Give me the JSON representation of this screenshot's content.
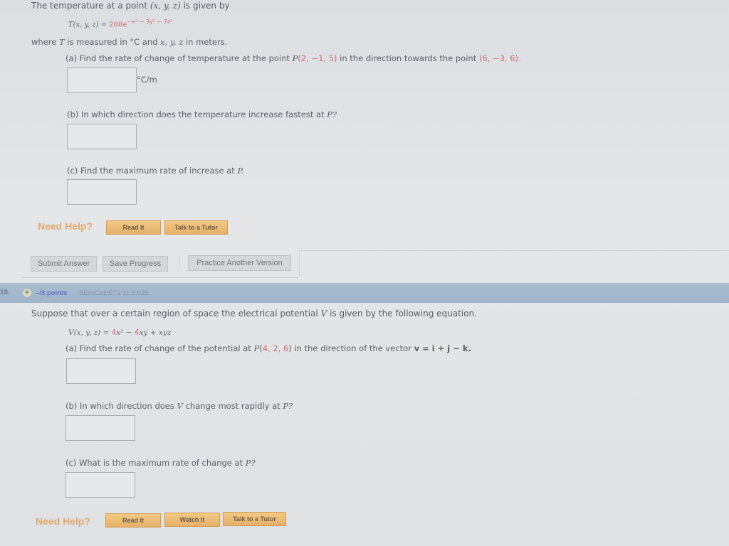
{
  "question9": {
    "intro": "The temperature at a point",
    "intro_vars": "(x, y, z)",
    "intro_end": "is given by",
    "formula_lhs": "T(x, y, z) =",
    "formula_coeff": "200e",
    "formula_exp": "−x² − 3y² − 7z²",
    "where_1": "where",
    "where_T": "T",
    "where_2": "is measured in °C and",
    "where_vars": "x, y, z",
    "where_3": "in meters.",
    "part_a": {
      "label": "(a) Find the rate of change of temperature at the point",
      "point_name": "P",
      "point": "(2, −1, 5)",
      "mid": "in the direction towards the point",
      "target": "(6, −3, 6).",
      "unit": "°C/m",
      "value": ""
    },
    "part_b": {
      "label": "(b) In which direction does the temperature increase fastest at",
      "point_name": "P?",
      "value": ""
    },
    "part_c": {
      "label": "(c) Find the maximum rate of increase at",
      "point_name": "P.",
      "value": ""
    },
    "help": {
      "label": "Need Help?",
      "buttons": [
        "Read It",
        "Talk to a Tutor"
      ]
    },
    "actions": {
      "submit": "Submit Answer",
      "save": "Save Progress",
      "practice": "Practice Another Version"
    }
  },
  "question10": {
    "number": "10.",
    "plus_icon": "+",
    "points": "–/3 points",
    "reference": "SEssCalcET2 11.6.025.",
    "intro": "Suppose that over a certain region of space the electrical potential",
    "intro_var": "V",
    "intro_end": "is given by the following equation.",
    "formula_lhs": "V(x, y, z) =",
    "formula_c1": "4",
    "formula_t1": "x² −",
    "formula_c2": "4",
    "formula_t2": "xy + xyz",
    "part_a": {
      "label": "(a) Find the rate of change of the potential at",
      "point_name": "P",
      "point_open": "(",
      "point": "4, 2, 6",
      "point_close": ")",
      "mid": "in the direction of the vector",
      "vector": "v = i + j − k.",
      "value": ""
    },
    "part_b": {
      "label_1": "(b) In which direction does",
      "var": "V",
      "label_2": "change most rapidly at",
      "point_name": "P?",
      "value": ""
    },
    "part_c": {
      "label": "(c) What is the maximum rate of change at",
      "point_name": "P?",
      "value": ""
    },
    "help": {
      "label": "Need Help?",
      "buttons": [
        "Read It",
        "Watch It",
        "Talk to a Tutor"
      ]
    }
  }
}
